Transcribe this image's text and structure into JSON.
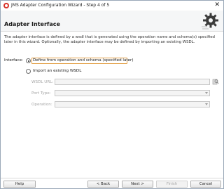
{
  "window": {
    "title": "JMS Adapter Configuration Wizard - Step 4 of 5",
    "close_glyph": "✕"
  },
  "header": {
    "title": "Adapter Interface"
  },
  "description": "The adapter interface is defined by a wsdl that is generated using the operation name and schema(s) specified later in this wizard.  Optionally, the adapter interface may be defined by importing an existing WSDL.",
  "interface": {
    "label": "Interface:",
    "options": [
      {
        "label": "Define from operation and schema (specified later)",
        "selected": true
      },
      {
        "label": "Import an existing WSDL",
        "selected": false
      }
    ]
  },
  "import_fields": {
    "wsdl_url_label": "WSDL URL:",
    "wsdl_url_value": "",
    "port_type_label": "Port Type:",
    "port_type_value": "",
    "operation_label": "Operation:",
    "operation_value": ""
  },
  "footer": {
    "help_label": "Help",
    "back_label": "< Back",
    "next_label": "Next >",
    "finish_label": "Finish",
    "cancel_label": "Cancel"
  },
  "icons": {
    "app": "oracle-app-icon",
    "header": "gear-icon",
    "browse": "browse-icon"
  },
  "colors": {
    "app_icon": "#d8332a",
    "focus_outline": "#e3a048",
    "disabled_text": "#a6a6a6",
    "header_bg": "#f5f6f7"
  }
}
